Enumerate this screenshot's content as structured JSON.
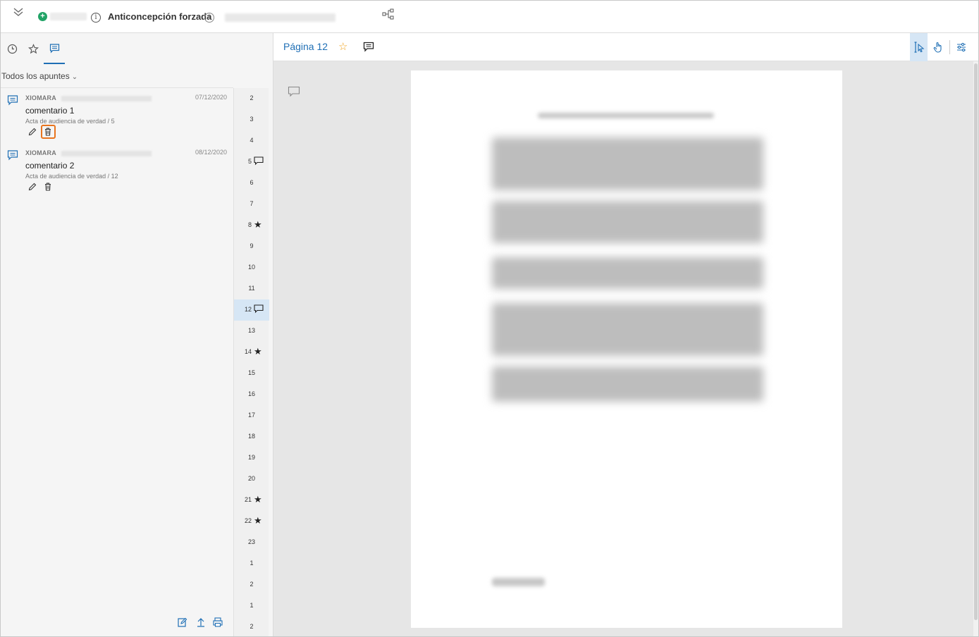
{
  "header": {
    "case_title": "Anticoncepción forzada"
  },
  "left_panel": {
    "filter_label": "Todos los apuntes",
    "notes": [
      {
        "author": "XIOMARA",
        "date": "07/12/2020",
        "text": "comentario 1",
        "reference": "Acta de audiencia de verdad / 5"
      },
      {
        "author": "XIOMARA",
        "date": "08/12/2020",
        "text": "comentario 2",
        "reference": "Acta de audiencia de verdad / 12"
      }
    ],
    "pages": [
      {
        "num": "2",
        "mark": ""
      },
      {
        "num": "3",
        "mark": ""
      },
      {
        "num": "4",
        "mark": ""
      },
      {
        "num": "5",
        "mark": "comment"
      },
      {
        "num": "6",
        "mark": ""
      },
      {
        "num": "7",
        "mark": ""
      },
      {
        "num": "8",
        "mark": "star"
      },
      {
        "num": "9",
        "mark": ""
      },
      {
        "num": "10",
        "mark": ""
      },
      {
        "num": "11",
        "mark": ""
      },
      {
        "num": "12",
        "mark": "comment",
        "active": true
      },
      {
        "num": "13",
        "mark": ""
      },
      {
        "num": "14",
        "mark": "star"
      },
      {
        "num": "15",
        "mark": ""
      },
      {
        "num": "16",
        "mark": ""
      },
      {
        "num": "17",
        "mark": ""
      },
      {
        "num": "18",
        "mark": ""
      },
      {
        "num": "19",
        "mark": ""
      },
      {
        "num": "20",
        "mark": ""
      },
      {
        "num": "21",
        "mark": "star"
      },
      {
        "num": "22",
        "mark": "star"
      },
      {
        "num": "23",
        "mark": ""
      },
      {
        "num": "1",
        "mark": ""
      },
      {
        "num": "2",
        "mark": ""
      },
      {
        "num": "1",
        "mark": ""
      },
      {
        "num": "2",
        "mark": ""
      }
    ]
  },
  "viewer": {
    "page_label": "Página 12"
  },
  "colors": {
    "accent": "#1f6fb5",
    "highlight": "#e8741e",
    "status_green": "#21a366",
    "star": "#f0a21b"
  }
}
